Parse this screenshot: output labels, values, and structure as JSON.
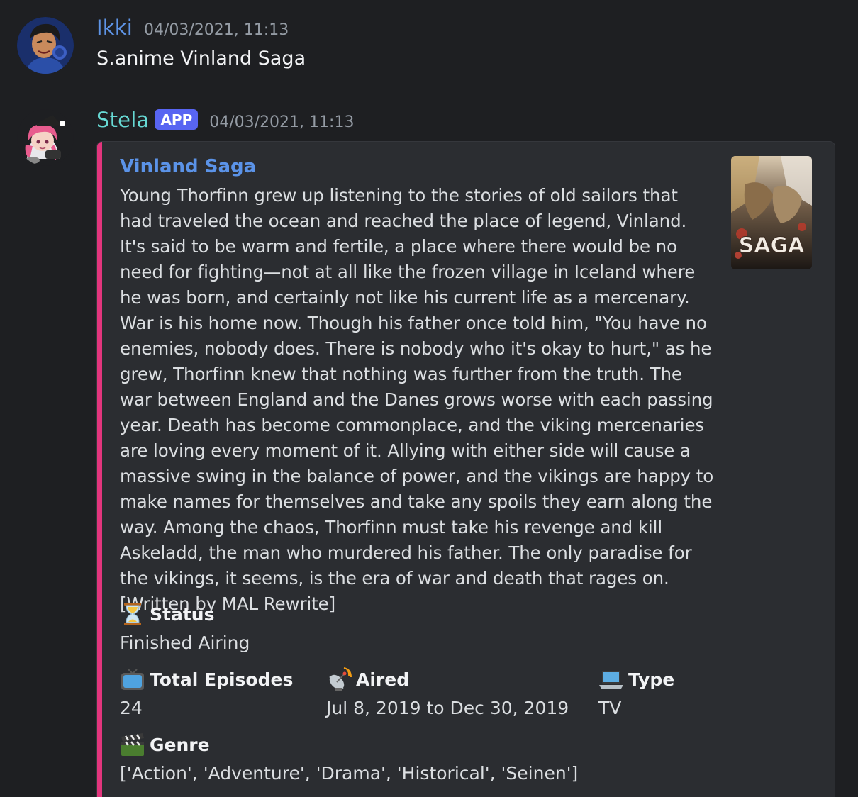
{
  "messages": [
    {
      "username": "Ikki",
      "username_color": "#5e94e6",
      "timestamp": "04/03/2021, 11:13",
      "content": "S.anime Vinland Saga"
    },
    {
      "username": "Stela",
      "username_color": "#67d9d4",
      "badge": "APP",
      "timestamp": "04/03/2021, 11:13"
    }
  ],
  "embed": {
    "accent_color": "#e2357d",
    "title": "Vinland Saga",
    "description": "Young Thorfinn grew up listening to the stories of old sailors that had traveled the ocean and reached the place of legend, Vinland. It's said to be warm and fertile, a place where there would be no need for fighting—not at all like the frozen village in Iceland where he was born, and certainly not like his current life as a mercenary. War is his home now. Though his father once told him, \"You have no enemies, nobody does. There is nobody who it's okay to hurt,\" as he grew, Thorfinn knew that nothing was further from the truth. The war between England and the Danes grows worse with each passing year. Death has become commonplace, and the viking mercenaries are loving every moment of it. Allying with either side will cause a massive swing in the balance of power, and the vikings are happy to make names for themselves and take any spoils they earn along the way. Among the chaos, Thorfinn must take his revenge and kill Askeladd, the man who murdered his father. The only paradise for the vikings, it seems, is the era of war and death that rages on. [Written by MAL Rewrite]",
    "thumbnail_text": "SAGA",
    "fields": {
      "status": {
        "icon": "hourglass-icon",
        "name": "Status",
        "value": "Finished Airing"
      },
      "episodes": {
        "icon": "television-icon",
        "name": "Total Episodes",
        "value": "24"
      },
      "aired": {
        "icon": "satellite-antenna-icon",
        "name": "Aired",
        "value": "Jul 8, 2019 to Dec 30, 2019"
      },
      "type": {
        "icon": "laptop-icon",
        "name": "Type",
        "value": "TV"
      },
      "genre": {
        "icon": "clapper-board-icon",
        "name": "Genre",
        "value": "['Action', 'Adventure', 'Drama', 'Historical', 'Seinen']"
      }
    }
  }
}
